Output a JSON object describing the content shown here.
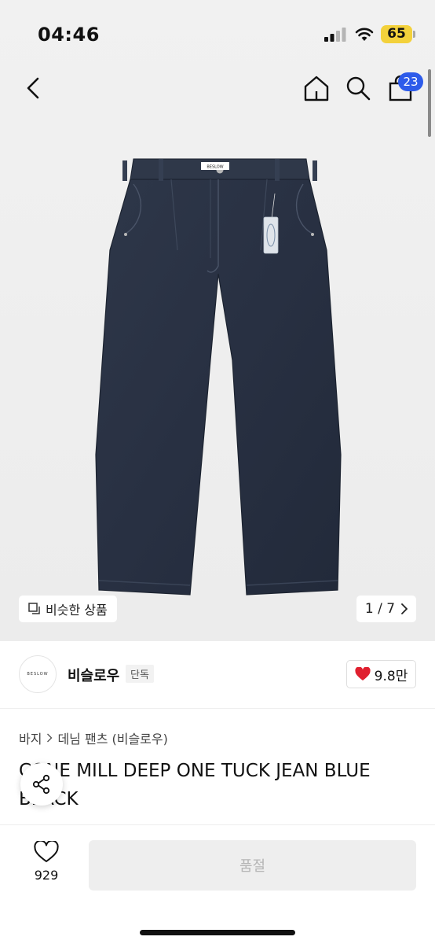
{
  "status": {
    "time": "04:46",
    "battery": "65"
  },
  "nav": {
    "cart_count": "23"
  },
  "gallery": {
    "similar_label": "비슷한 상품",
    "page_indicator": "1 / 7",
    "tag_brand": "BESLOW"
  },
  "brand": {
    "logo_text": "BESLOW",
    "name": "비슬로우",
    "badge": "단독",
    "likes": "9.8만"
  },
  "breadcrumb": {
    "category": "바지",
    "subcategory": "데님 팬츠 (비슬로우)"
  },
  "product": {
    "title": "CONE MILL DEEP ONE TUCK JEAN BLUE BLACK"
  },
  "bottom": {
    "wish_count": "929",
    "cta_label": "품절"
  },
  "colors": {
    "accent": "#2d5bea",
    "heart": "#e0202f",
    "denim": "#2b3445",
    "battery": "#f3d13b"
  }
}
